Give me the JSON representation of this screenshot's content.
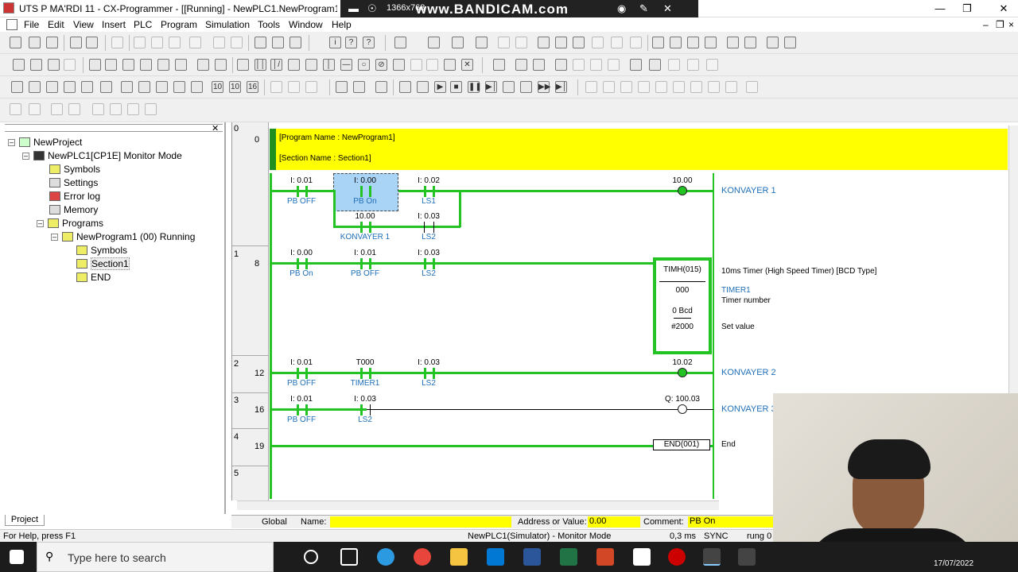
{
  "window": {
    "title": "UTS P MA'RDI 11 - CX-Programmer - [[Running] - NewPLC1.NewProgram1.Secti",
    "recorder_brand": "www.BANDICAM.com",
    "recorder_resolution": "1366x768"
  },
  "menu": [
    "File",
    "Edit",
    "View",
    "Insert",
    "PLC",
    "Program",
    "Simulation",
    "Tools",
    "Window",
    "Help"
  ],
  "tree": {
    "items": [
      {
        "label": "NewProject",
        "level": 0
      },
      {
        "label": "NewPLC1[CP1E] Monitor Mode",
        "level": 1
      },
      {
        "label": "Symbols",
        "level": 2
      },
      {
        "label": "Settings",
        "level": 2
      },
      {
        "label": "Error log",
        "level": 2
      },
      {
        "label": "Memory",
        "level": 2
      },
      {
        "label": "Programs",
        "level": 2
      },
      {
        "label": "NewProgram1 (00) Running",
        "level": 3
      },
      {
        "label": "Symbols",
        "level": 4
      },
      {
        "label": "Section1",
        "level": 4
      },
      {
        "label": "END",
        "level": 4
      }
    ],
    "tab_label": "Project"
  },
  "ladder": {
    "header_line1": "[Program Name : NewProgram1]",
    "header_line2": "[Section Name : Section1]",
    "rungs": [
      {
        "rung": "0",
        "step": "0"
      },
      {
        "rung": "1",
        "step": "8"
      },
      {
        "rung": "2",
        "step": "12"
      },
      {
        "rung": "3",
        "step": "16"
      },
      {
        "rung": "4",
        "step": "19"
      },
      {
        "rung": "5",
        "step": ""
      }
    ],
    "r0": {
      "c1_addr": "I: 0.01",
      "c1_cmt": "PB OFF",
      "c2_addr": "I: 0.00",
      "c2_cmt": "PB On",
      "c3_addr": "I: 0.02",
      "c3_cmt": "LS1",
      "c4_addr": "10.00",
      "c4_cmt": "KONVAYER 1",
      "c5_addr": "I: 0.03",
      "c5_cmt": "LS2",
      "out_addr": "10.00",
      "out_name": "KONVAYER 1"
    },
    "r1": {
      "c1_addr": "I: 0.00",
      "c1_cmt": "PB On",
      "c2_addr": "I: 0.01",
      "c2_cmt": "PB OFF",
      "c3_addr": "I: 0.03",
      "c3_cmt": "LS2",
      "timer_instr": "TIMH(015)",
      "timer_num": "000",
      "timer_pv": "0 Bcd",
      "timer_sv": "#2000",
      "desc": "10ms Timer (High Speed Timer) [BCD Type]",
      "timer_sym": "TIMER1",
      "timer_num_label": "Timer number",
      "set_value_label": "Set value"
    },
    "r2": {
      "c1_addr": "I: 0.01",
      "c1_cmt": "PB OFF",
      "c2_addr": "T000",
      "c2_cmt": "TIMER1",
      "c3_addr": "I: 0.03",
      "c3_cmt": "LS2",
      "out_addr": "10.02",
      "out_name": "KONVAYER 2"
    },
    "r3": {
      "c1_addr": "I: 0.01",
      "c1_cmt": "PB OFF",
      "c2_addr": "I: 0.03",
      "c2_cmt": "LS2",
      "out_addr": "Q: 100.03",
      "out_name": "KONVAYER 3"
    },
    "r4": {
      "end_instr": "END(001)",
      "end_label": "End"
    }
  },
  "bottom": {
    "global_tab": "Global",
    "name_label": "Name:",
    "addr_label": "Address or Value:",
    "addr_value": "0.00",
    "comment_label": "Comment:",
    "comment_value": "PB On"
  },
  "status": {
    "help": "For Help, press F1",
    "mode": "NewPLC1(Simulator) - Monitor Mode",
    "scan": "0,3 ms",
    "sync": "SYNC",
    "rung": "rung 0"
  },
  "taskbar": {
    "search_placeholder": "Type here to search",
    "date": "17/07/2022"
  }
}
